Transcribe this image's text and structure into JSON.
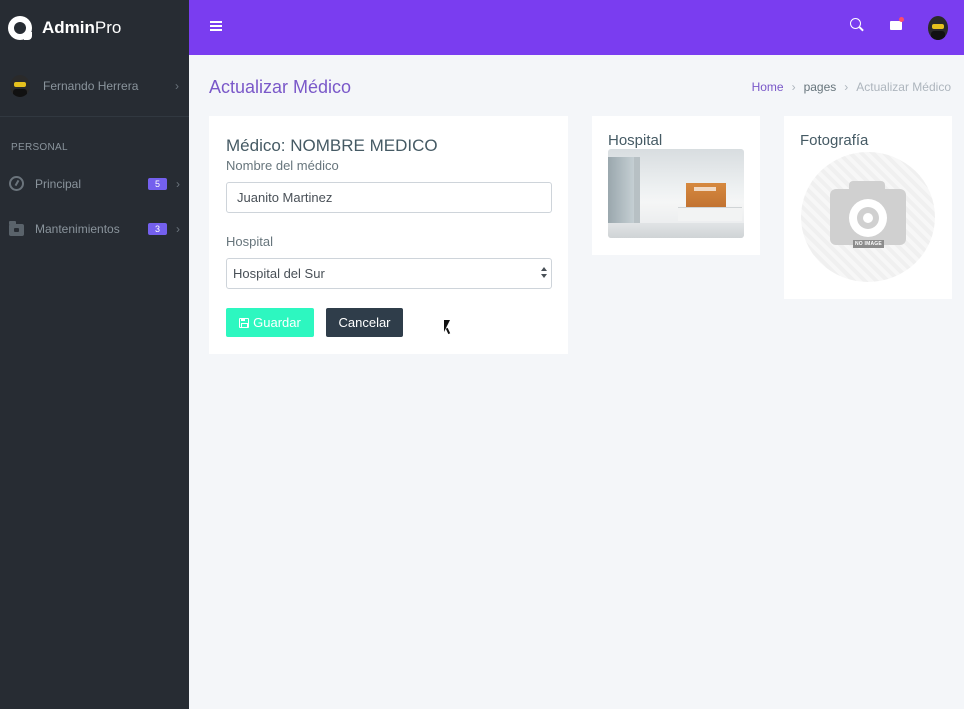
{
  "brand": {
    "name_bold": "Admin",
    "name_light": "Pro"
  },
  "sidebar": {
    "user": {
      "name": "Fernando Herrera",
      "avatar_icon": "batman-avatar-icon"
    },
    "section": "PERSONAL",
    "items": [
      {
        "label": "Principal",
        "badge": "5",
        "icon": "gauge-icon"
      },
      {
        "label": "Mantenimientos",
        "badge": "3",
        "icon": "folder-icon"
      }
    ]
  },
  "topbar": {
    "icons": [
      "menu-icon",
      "search-icon",
      "mail-icon",
      "user-avatar-icon"
    ]
  },
  "page": {
    "title": "Actualizar Médico",
    "breadcrumb": [
      "Home",
      "pages",
      "Actualizar Médico"
    ]
  },
  "form": {
    "heading": "Médico: NOMBRE MEDICO",
    "name_label": "Nombre del médico",
    "name_value": "Juanito Martinez",
    "hospital_label": "Hospital",
    "hospital_value": "Hospital del Sur",
    "save_label": "Guardar",
    "cancel_label": "Cancelar"
  },
  "hospital_card": {
    "title": "Hospital"
  },
  "photo_card": {
    "title": "Fotografía",
    "placeholder_text": "NO IMAGE"
  },
  "colors": {
    "sidebar": "#272c33",
    "topbar": "#7a3df0",
    "accent": "#7a58c9",
    "save_button": "#2df7c0",
    "cancel_button": "#2f3d4a",
    "badge": "#7460ee"
  }
}
